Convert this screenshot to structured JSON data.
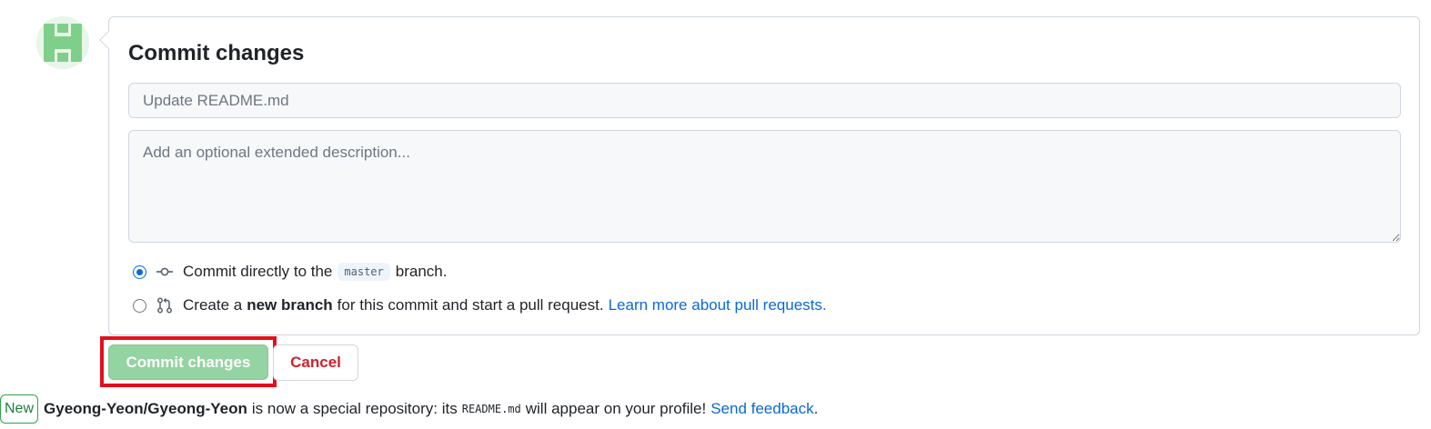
{
  "commit_form": {
    "title": "Commit changes",
    "summary_placeholder": "Update README.md",
    "description_placeholder": "Add an optional extended description...",
    "option_direct": {
      "prefix": "Commit directly to the",
      "branch": "master",
      "suffix": "branch.",
      "selected": true,
      "icon": "git-commit-icon"
    },
    "option_new_branch": {
      "prefix": "Create a",
      "bold": "new branch",
      "suffix": "for this commit and start a pull request.",
      "link": "Learn more about pull requests.",
      "selected": false,
      "icon": "git-pull-request-icon"
    }
  },
  "actions": {
    "commit_label": "Commit changes",
    "cancel_label": "Cancel"
  },
  "notice": {
    "badge": "New",
    "repo": "Gyeong-Yeon/Gyeong-Yeon",
    "text_1": "is now a special repository: its",
    "file": "README.md",
    "text_2": "will appear on your profile!",
    "link": "Send feedback",
    "end": "."
  },
  "colors": {
    "primary_disabled": "#94d3a2",
    "danger": "#cf222e",
    "link": "#0969da",
    "highlight": "#e3101b"
  }
}
